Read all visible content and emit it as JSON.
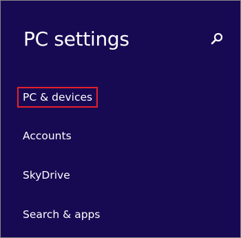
{
  "header": {
    "title": "PC settings",
    "search_icon": "search-icon"
  },
  "nav": {
    "items": [
      {
        "label": "PC & devices",
        "selected": true
      },
      {
        "label": "Accounts",
        "selected": false
      },
      {
        "label": "SkyDrive",
        "selected": false
      },
      {
        "label": "Search & apps",
        "selected": false
      }
    ]
  },
  "colors": {
    "background": "#180a52",
    "text": "#ffffff",
    "highlight_border": "#e8202a"
  }
}
